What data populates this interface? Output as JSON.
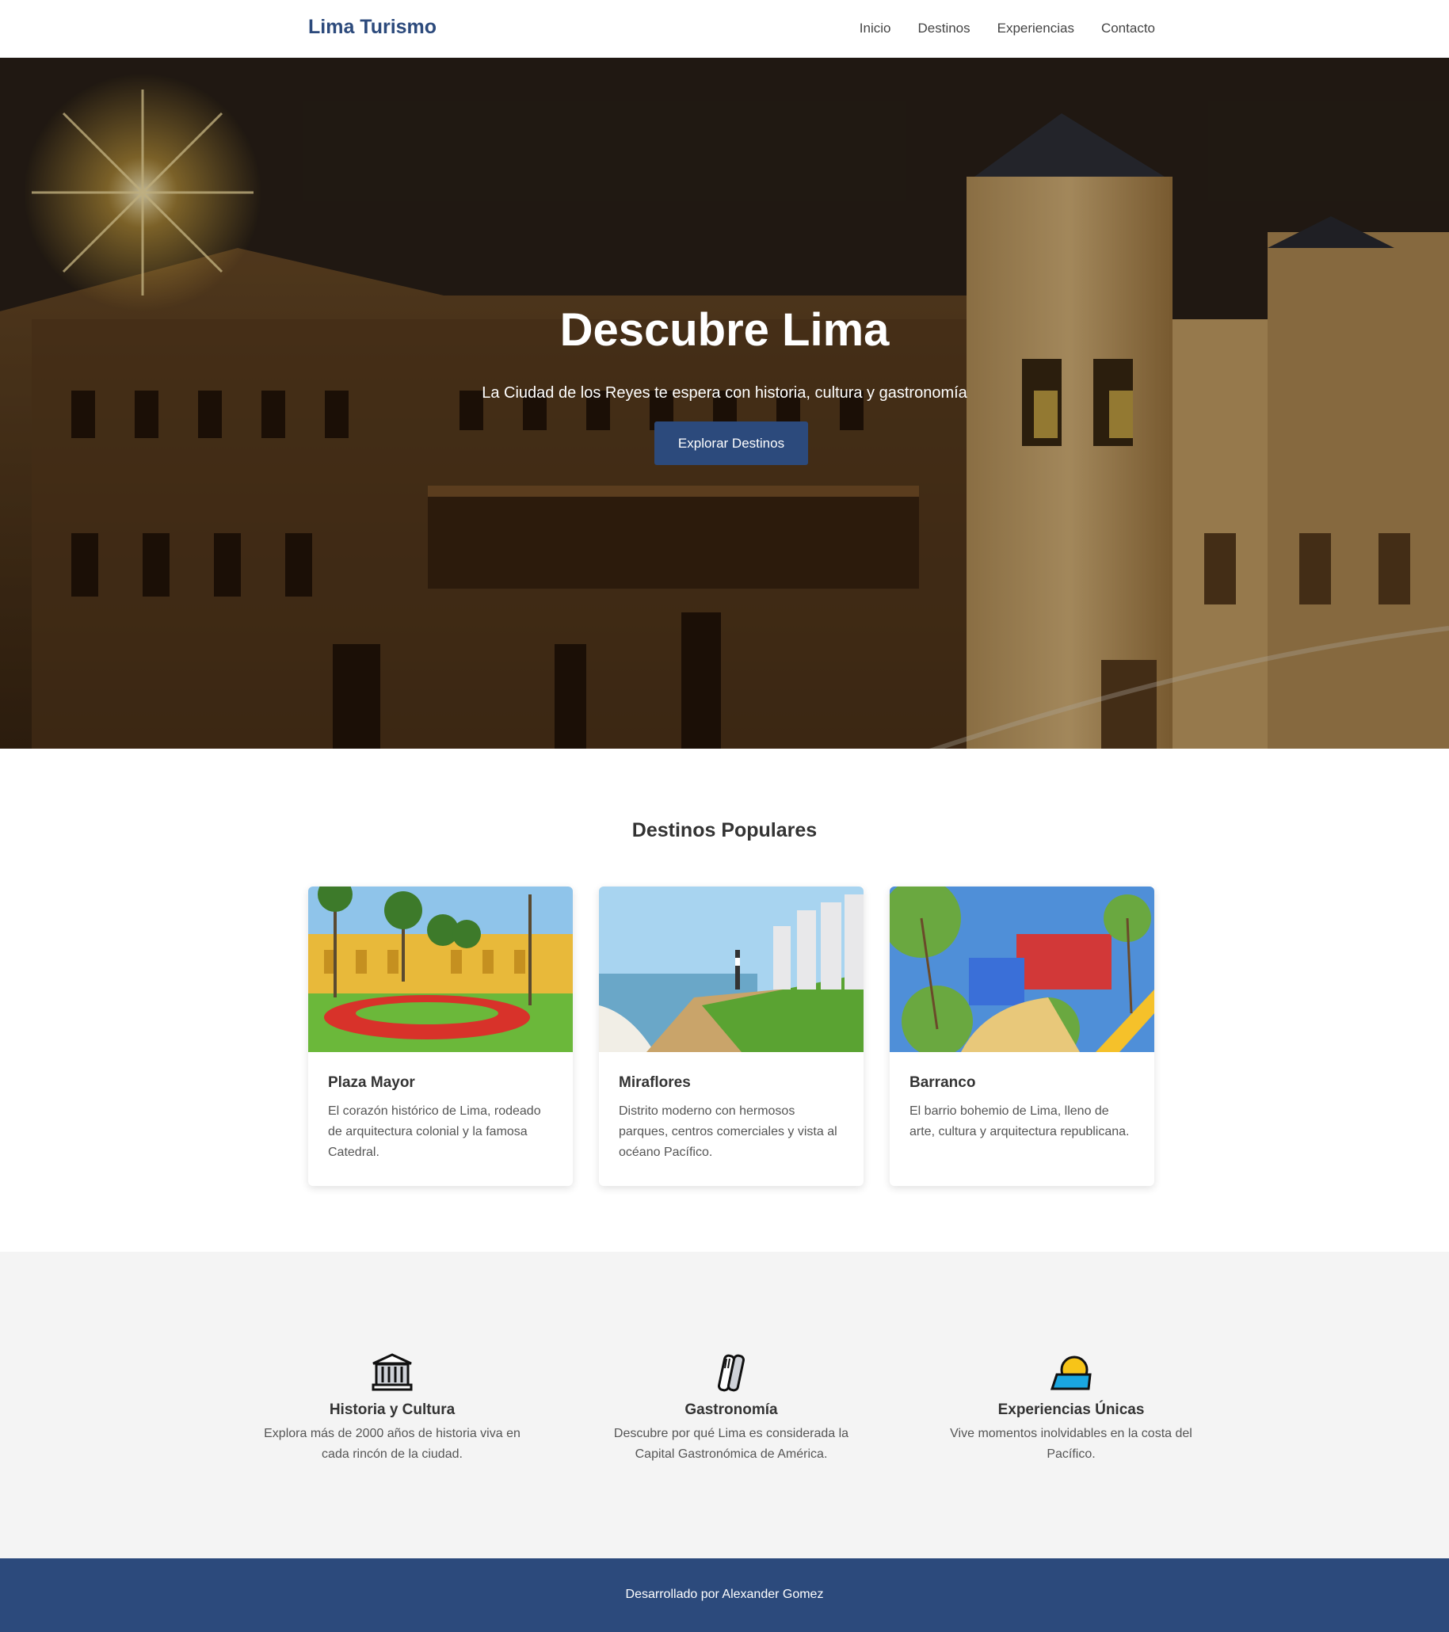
{
  "header": {
    "logo": "Lima Turismo",
    "nav": [
      "Inicio",
      "Destinos",
      "Experiencias",
      "Contacto"
    ]
  },
  "hero": {
    "title": "Descubre Lima",
    "subtitle": "La Ciudad de los Reyes te espera con historia, cultura y gastronomía",
    "button": "Explorar Destinos"
  },
  "destinos": {
    "title": "Destinos Populares",
    "cards": [
      {
        "title": "Plaza Mayor",
        "text": "El corazón histórico de Lima, rodeado de arquitectura colonial y la famosa Catedral."
      },
      {
        "title": "Miraflores",
        "text": "Distrito moderno con hermosos parques, centros comerciales y vista al océano Pacífico."
      },
      {
        "title": "Barranco",
        "text": "El barrio bohemio de Lima, lleno de arte, cultura y arquitectura republicana."
      }
    ]
  },
  "features": [
    {
      "icon": "classical-building-icon",
      "title": "Historia y Cultura",
      "text": "Explora más de 2000 años de historia viva en cada rincón de la ciudad."
    },
    {
      "icon": "fork-knife-icon",
      "title": "Gastronomía",
      "text": "Descubre por qué Lima es considerada la Capital Gastronómica de América."
    },
    {
      "icon": "sunset-sea-icon",
      "title": "Experiencias Únicas",
      "text": "Vive momentos inolvidables en la costa del Pacífico."
    }
  ],
  "footer": {
    "text": "Desarrollado por Alexander Gomez"
  },
  "colors": {
    "brand": "#2c4a7c",
    "feature_bg": "#f4f4f4"
  }
}
